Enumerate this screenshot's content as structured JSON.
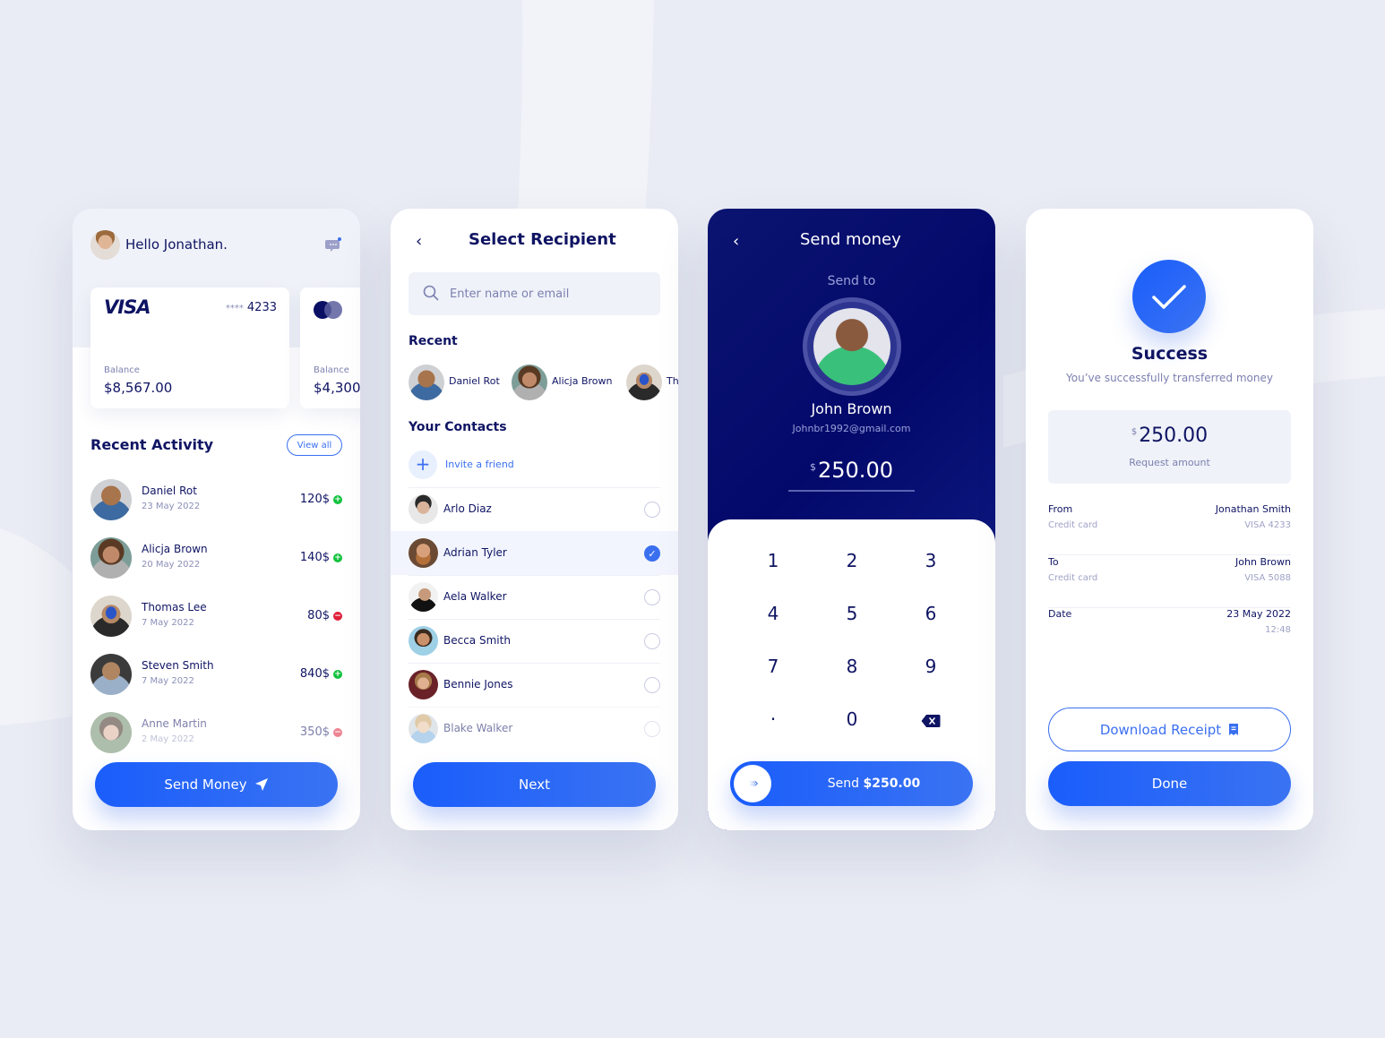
{
  "colors": {
    "primary": "#1a5dfb",
    "navy": "#0f1463",
    "positive": "#12c23d",
    "negative": "#e0203a",
    "background": "#e9ecf4"
  },
  "home": {
    "greeting": "Hello Jonathan.",
    "cards": [
      {
        "brand": "VISA",
        "masked": "****",
        "last4": "4233",
        "balance_label": "Balance",
        "balance": "$8,567.00"
      },
      {
        "brand": "mastercard",
        "balance_label": "Balance",
        "balance": "$4,300"
      }
    ],
    "recent_activity_title": "Recent Activity",
    "view_all": "View all",
    "activity": [
      {
        "name": "Daniel Rot",
        "date": "23 May 2022",
        "amount": "120$",
        "type": "credit"
      },
      {
        "name": "Alicja Brown",
        "date": "20 May 2022",
        "amount": "140$",
        "type": "credit"
      },
      {
        "name": "Thomas Lee",
        "date": "7 May 2022",
        "amount": "80$",
        "type": "debit"
      },
      {
        "name": "Steven Smith",
        "date": "7 May 2022",
        "amount": "840$",
        "type": "credit"
      },
      {
        "name": "Anne Martin",
        "date": "2 May 2022",
        "amount": "350$",
        "type": "debit"
      }
    ],
    "send_money_label": "Send Money"
  },
  "select_recipient": {
    "title": "Select Recipient",
    "search_placeholder": "Enter name or email",
    "recent_title": "Recent",
    "recent": [
      "Daniel Rot",
      "Alicja Brown",
      "Th"
    ],
    "contacts_title": "Your Contacts",
    "invite_label": "Invite a friend",
    "contacts": [
      {
        "name": "Arlo Diaz",
        "selected": false
      },
      {
        "name": "Adrian Tyler",
        "selected": true
      },
      {
        "name": "Aela Walker",
        "selected": false
      },
      {
        "name": "Becca Smith",
        "selected": false
      },
      {
        "name": "Bennie Jones",
        "selected": false
      },
      {
        "name": "Blake Walker",
        "selected": false
      }
    ],
    "next_label": "Next"
  },
  "send_money": {
    "title": "Send money",
    "send_to_label": "Send to",
    "recipient_name": "John Brown",
    "recipient_email": "Johnbr1992@gmail.com",
    "currency": "$",
    "amount": "250.00",
    "keys": [
      "1",
      "2",
      "3",
      "4",
      "5",
      "6",
      "7",
      "8",
      "9",
      "·",
      "0",
      "⌫"
    ],
    "send_prefix": "Send",
    "send_amount": "$250.00"
  },
  "success": {
    "title": "Success",
    "subtitle": "You’ve successfully transferred money",
    "currency": "$",
    "amount": "250.00",
    "amount_label": "Request amount",
    "details": [
      {
        "label": "From",
        "sub": "Credit card",
        "value": "Jonathan Smith",
        "value_sub": "VISA 4233"
      },
      {
        "label": "To",
        "sub": "Credit card",
        "value": "John Brown",
        "value_sub": "VISA 5088"
      },
      {
        "label": "Date",
        "sub": "",
        "value": "23 May 2022",
        "value_sub": "12:48"
      }
    ],
    "download_label": "Download Receipt",
    "done_label": "Done"
  }
}
